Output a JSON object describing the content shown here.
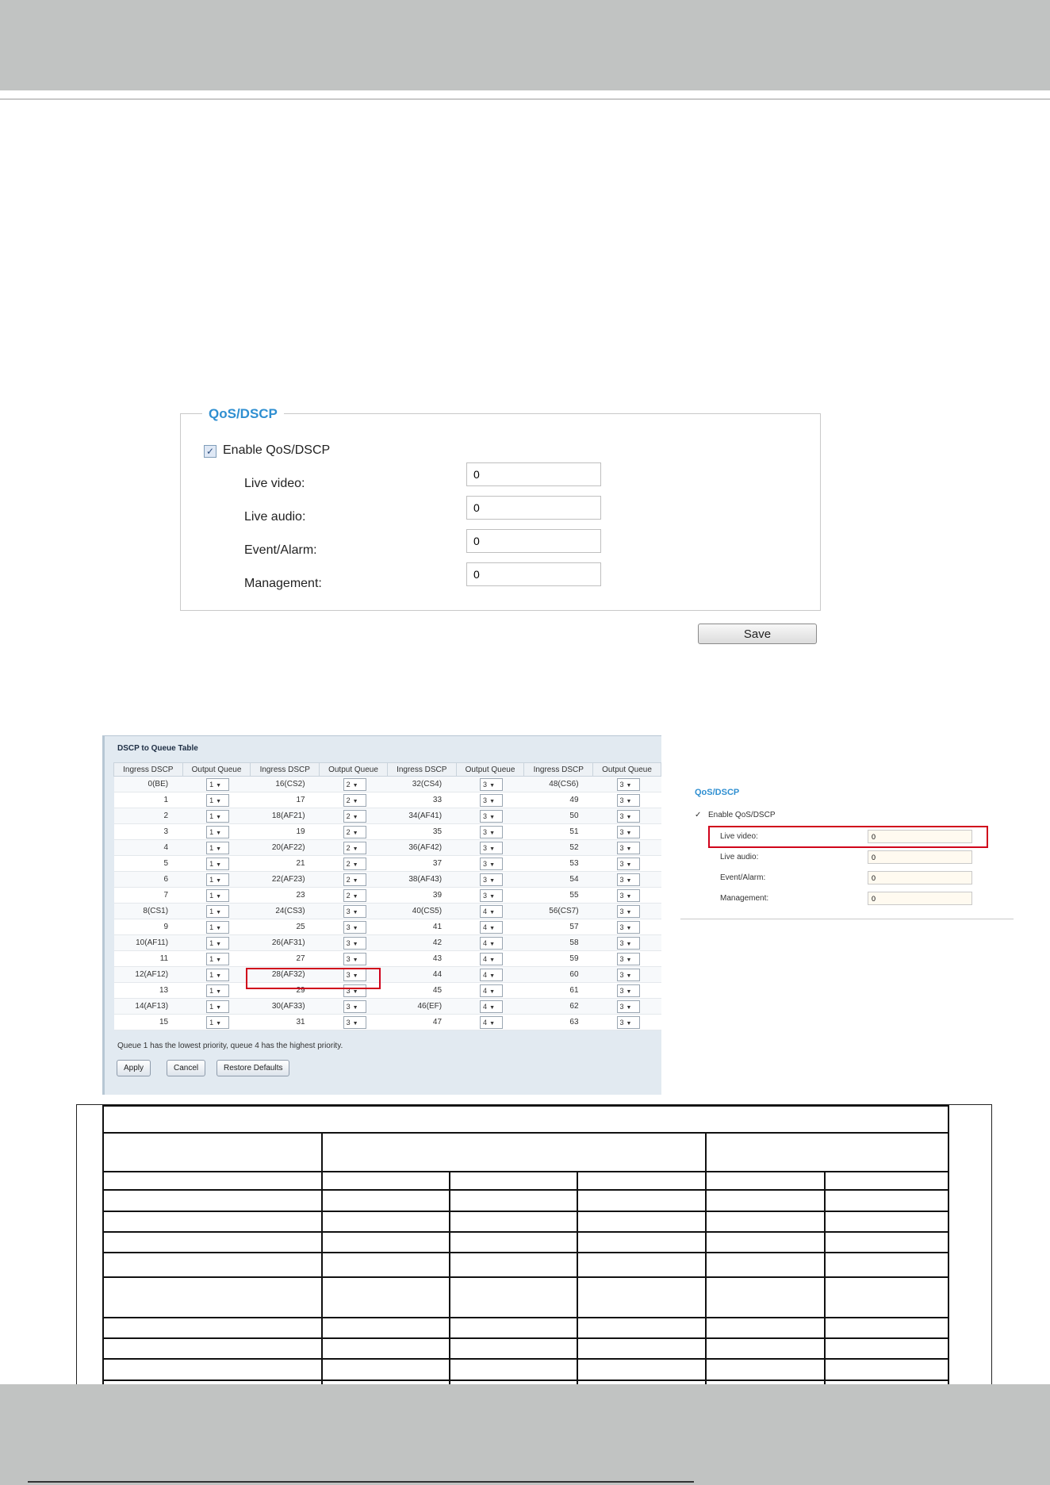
{
  "qos": {
    "legend": "QoS/DSCP",
    "enable_label": "Enable QoS/DSCP",
    "enable_checked": true,
    "fields": [
      {
        "label": "Live video:",
        "value": "0"
      },
      {
        "label": "Live audio:",
        "value": "0"
      },
      {
        "label": "Event/Alarm:",
        "value": "0"
      },
      {
        "label": "Management:",
        "value": "0"
      }
    ],
    "save_label": "Save"
  },
  "dscp_table": {
    "title": "DSCP to Queue Table",
    "headers": [
      "Ingress DSCP",
      "Output Queue",
      "Ingress DSCP",
      "Output Queue",
      "Ingress DSCP",
      "Output Queue",
      "Ingress DSCP",
      "Output Queue"
    ],
    "rows": [
      [
        "0(BE)",
        "1",
        "16(CS2)",
        "2",
        "32(CS4)",
        "3",
        "48(CS6)",
        "3"
      ],
      [
        "1",
        "1",
        "17",
        "2",
        "33",
        "3",
        "49",
        "3"
      ],
      [
        "2",
        "1",
        "18(AF21)",
        "2",
        "34(AF41)",
        "3",
        "50",
        "3"
      ],
      [
        "3",
        "1",
        "19",
        "2",
        "35",
        "3",
        "51",
        "3"
      ],
      [
        "4",
        "1",
        "20(AF22)",
        "2",
        "36(AF42)",
        "3",
        "52",
        "3"
      ],
      [
        "5",
        "1",
        "21",
        "2",
        "37",
        "3",
        "53",
        "3"
      ],
      [
        "6",
        "1",
        "22(AF23)",
        "2",
        "38(AF43)",
        "3",
        "54",
        "3"
      ],
      [
        "7",
        "1",
        "23",
        "2",
        "39",
        "3",
        "55",
        "3"
      ],
      [
        "8(CS1)",
        "1",
        "24(CS3)",
        "3",
        "40(CS5)",
        "4",
        "56(CS7)",
        "3"
      ],
      [
        "9",
        "1",
        "25",
        "3",
        "41",
        "4",
        "57",
        "3"
      ],
      [
        "10(AF11)",
        "1",
        "26(AF31)",
        "3",
        "42",
        "4",
        "58",
        "3"
      ],
      [
        "11",
        "1",
        "27",
        "3",
        "43",
        "4",
        "59",
        "3"
      ],
      [
        "12(AF12)",
        "1",
        "28(AF32)",
        "3",
        "44",
        "4",
        "60",
        "3"
      ],
      [
        "13",
        "1",
        "29",
        "3",
        "45",
        "4",
        "61",
        "3"
      ],
      [
        "14(AF13)",
        "1",
        "30(AF33)",
        "3",
        "46(EF)",
        "4",
        "62",
        "3"
      ],
      [
        "15",
        "1",
        "31",
        "3",
        "47",
        "4",
        "63",
        "3"
      ]
    ],
    "note": "Queue 1 has the lowest priority, queue 4 has the highest priority.",
    "buttons": {
      "apply": "Apply",
      "cancel": "Cancel",
      "restore": "Restore Defaults"
    },
    "select_arrow": "▼"
  },
  "mini_qos": {
    "title": "QoS/DSCP",
    "check_mark": "✓",
    "enable_label": "Enable QoS/DSCP",
    "fields": [
      {
        "label": "Live video:",
        "value": "0"
      },
      {
        "label": "Live audio:",
        "value": "0"
      },
      {
        "label": "Event/Alarm:",
        "value": "0"
      },
      {
        "label": "Management:",
        "value": "0"
      }
    ]
  },
  "colors": {
    "header_band": "#c1c3c2",
    "accent_blue": "#2f8fd1",
    "highlight_red": "#d0021b"
  }
}
